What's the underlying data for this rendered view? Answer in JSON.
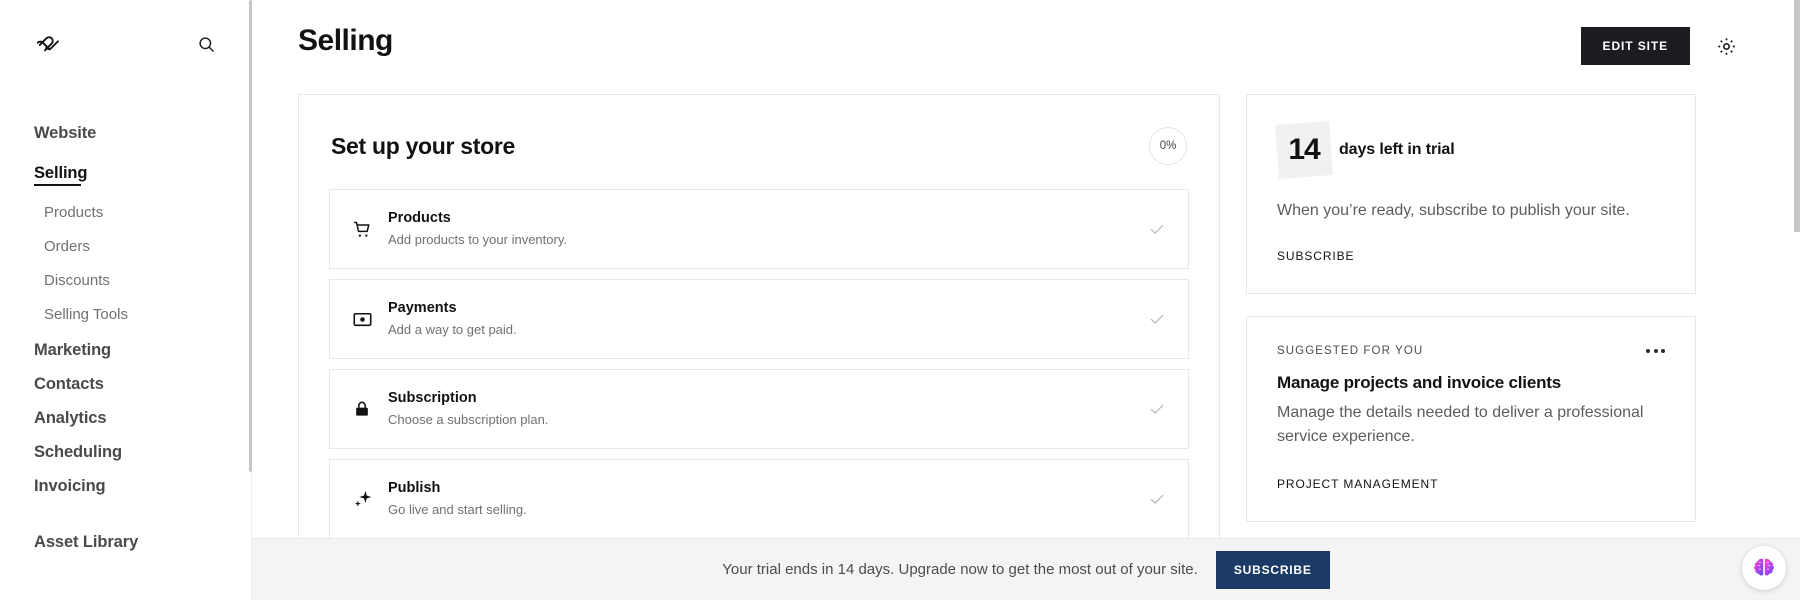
{
  "sidebar": {
    "logo_icon": "squarespace-logo",
    "search_icon": "search-icon",
    "items": [
      {
        "label": "Website",
        "type": "main",
        "active": false
      },
      {
        "label": "Selling",
        "type": "main",
        "active": true
      },
      {
        "label": "Products",
        "type": "sub",
        "active": false
      },
      {
        "label": "Orders",
        "type": "sub",
        "active": false
      },
      {
        "label": "Discounts",
        "type": "sub",
        "active": false
      },
      {
        "label": "Selling Tools",
        "type": "sub",
        "active": false
      },
      {
        "label": "Marketing",
        "type": "main",
        "active": false
      },
      {
        "label": "Contacts",
        "type": "main",
        "active": false
      },
      {
        "label": "Analytics",
        "type": "main",
        "active": false
      },
      {
        "label": "Scheduling",
        "type": "main",
        "active": false
      },
      {
        "label": "Invoicing",
        "type": "main",
        "active": false
      },
      {
        "label": "Asset Library",
        "type": "main",
        "active": false
      }
    ]
  },
  "header": {
    "title": "Selling",
    "edit_site_label": "EDIT SITE",
    "settings_icon": "gear-icon"
  },
  "store_setup": {
    "title": "Set up your store",
    "progress_label": "0%",
    "tasks": [
      {
        "icon": "shopping-cart-icon",
        "title": "Products",
        "desc": "Add products to your inventory.",
        "check": "checkmark-icon"
      },
      {
        "icon": "payment-card-icon",
        "title": "Payments",
        "desc": "Add a way to get paid.",
        "check": "checkmark-icon"
      },
      {
        "icon": "lock-icon",
        "title": "Subscription",
        "desc": "Choose a subscription plan.",
        "check": "checkmark-icon"
      },
      {
        "icon": "sparkle-icon",
        "title": "Publish",
        "desc": "Go live and start selling.",
        "check": "checkmark-icon"
      }
    ]
  },
  "trial_card": {
    "days": "14",
    "days_label": "days left in trial",
    "description": "When you’re ready, subscribe to publish your site.",
    "subscribe_label": "SUBSCRIBE"
  },
  "suggested_card": {
    "kicker": "SUGGESTED FOR YOU",
    "menu_icon": "ellipsis-icon",
    "title": "Manage projects and invoice clients",
    "description": "Manage the details needed to deliver a professional service experience.",
    "tag": "PROJECT MANAGEMENT"
  },
  "banner": {
    "text": "Your trial ends in 14 days. Upgrade now to get the most out of your site.",
    "button_label": "SUBSCRIBE",
    "assistant_icon": "ai-brain-icon"
  },
  "colors": {
    "accent_dark": "#1a1c1f",
    "banner_button": "#1b3a66",
    "text_primary": "#111214",
    "text_muted": "#6e7175",
    "border": "#e6e8ea"
  }
}
